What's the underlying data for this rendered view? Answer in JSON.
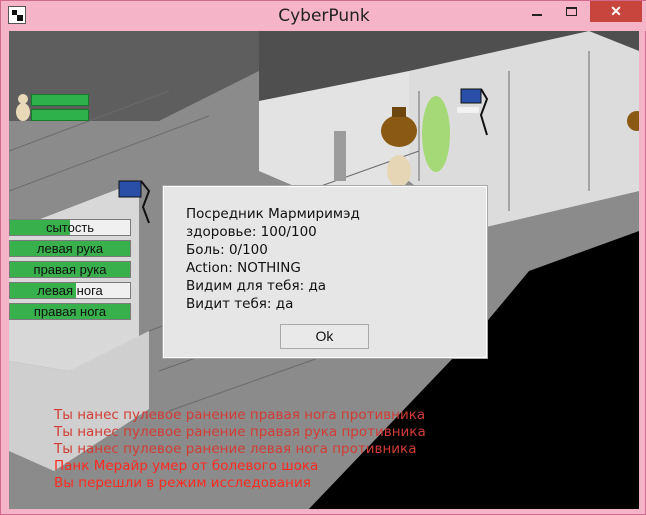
{
  "window": {
    "title": "CyberPunk",
    "controls": {
      "minimize": "–",
      "maximize": "□",
      "close": "✕"
    }
  },
  "hud": {
    "health_bars": [
      1,
      1
    ],
    "status_list": [
      {
        "label": "сытость",
        "fill": 0.5
      },
      {
        "label": "левая рука",
        "fill": 1.0
      },
      {
        "label": "правая рука",
        "fill": 1.0
      },
      {
        "label": "левая нога",
        "fill": 0.55
      },
      {
        "label": "правая нога",
        "fill": 1.0
      }
    ]
  },
  "dialog": {
    "lines": [
      "Посредник Мармиримэд",
      "здоровье: 100/100",
      "Боль: 0/100",
      "Action: NOTHING",
      "Видим для тебя: да",
      "Видит тебя: да"
    ],
    "ok_label": "Ok"
  },
  "log": [
    "Ты нанес пулевое ранение правая нога противника",
    "Ты нанес пулевое ранение правая рука противника",
    "Ты нанес пулевое ранение левая нога противника",
    "Панк Мерайр умер от болевого шока",
    "Вы перешли в режим исследования"
  ],
  "colors": {
    "log_text": "#ff2a20",
    "status_fill": "#38b04b",
    "wall_light": "#dedede",
    "wall_dark": "#5d5d5d",
    "floor": "#8a8a8a"
  }
}
